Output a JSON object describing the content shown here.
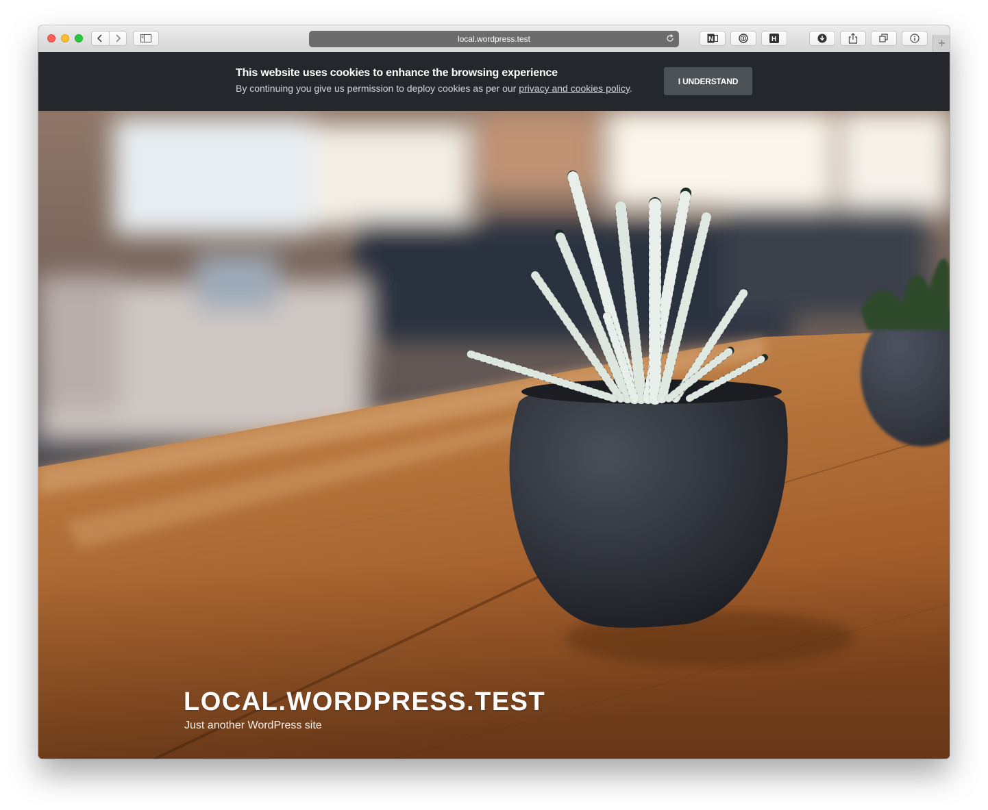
{
  "browser": {
    "url": "local.wordpress.test",
    "toolbar_icons": [
      "back-icon",
      "forward-icon",
      "sidebar-icon",
      "reload-icon",
      "onenote-icon",
      "1password-icon",
      "h-extension-icon",
      "downloads-icon",
      "share-icon",
      "tabs-icon",
      "info-icon",
      "new-tab-icon"
    ]
  },
  "cookie_banner": {
    "title": "This website uses cookies to enhance the browsing experience",
    "text_before": "By continuing you give us permission to deploy cookies as per our ",
    "link_text": "privacy and cookies policy",
    "text_after": ".",
    "button_label": "I UNDERSTAND"
  },
  "hero": {
    "site_title": "LOCAL.WORDPRESS.TEST",
    "tagline": "Just another WordPress site"
  },
  "colors": {
    "cookie_bar": "#24282c",
    "cookie_button": "#4d5257",
    "address_bar": "#6c6c6c"
  }
}
